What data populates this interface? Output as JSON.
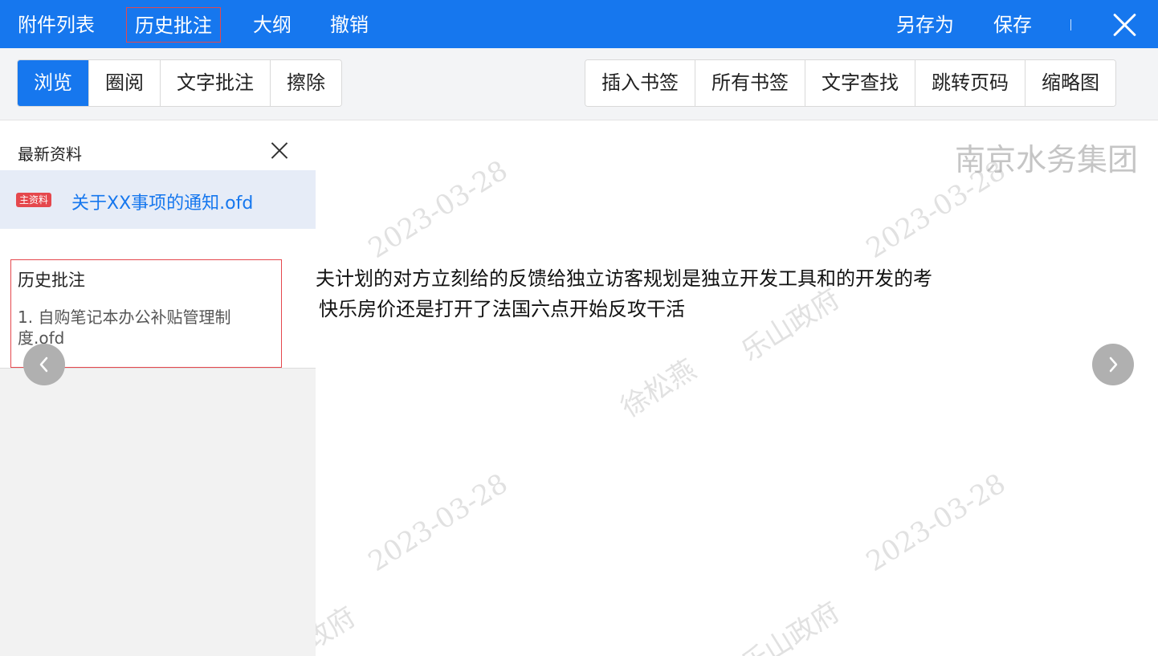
{
  "topbar": {
    "attachments": "附件列表",
    "history_annotations": "历史批注",
    "outline": "大纲",
    "undo": "撤销",
    "save_as": "另存为",
    "save": "保存",
    "separator": "|"
  },
  "toolbar": {
    "left": [
      "浏览",
      "圈阅",
      "文字批注",
      "擦除"
    ],
    "right": [
      "插入书签",
      "所有书签",
      "文字查找",
      "跳转页码",
      "缩略图"
    ],
    "active": "浏览"
  },
  "sidebar": {
    "title": "最新资料",
    "file_badge": "主资料",
    "file_name": "关于XX事项的通知.ofd",
    "history_title": "历史批注",
    "history_item": "1. 自购笔记本办公补贴管理制度.ofd"
  },
  "document": {
    "line1": "夫计划的对方立刻给的反馈给独立访客规划是独立开发工具和的开发的考",
    "line2": "快乐房价还是打开了法国六点开始反攻干活",
    "org_watermark": "南京水务集团",
    "date_watermark": "2023-03-28",
    "user_watermark": "徐松燕",
    "gov_watermark": "乐山政府",
    "gov_watermark_short": "政府"
  },
  "colors": {
    "primary": "#1677ee",
    "highlight_border": "#e5484d",
    "badge": "#e5484d"
  }
}
